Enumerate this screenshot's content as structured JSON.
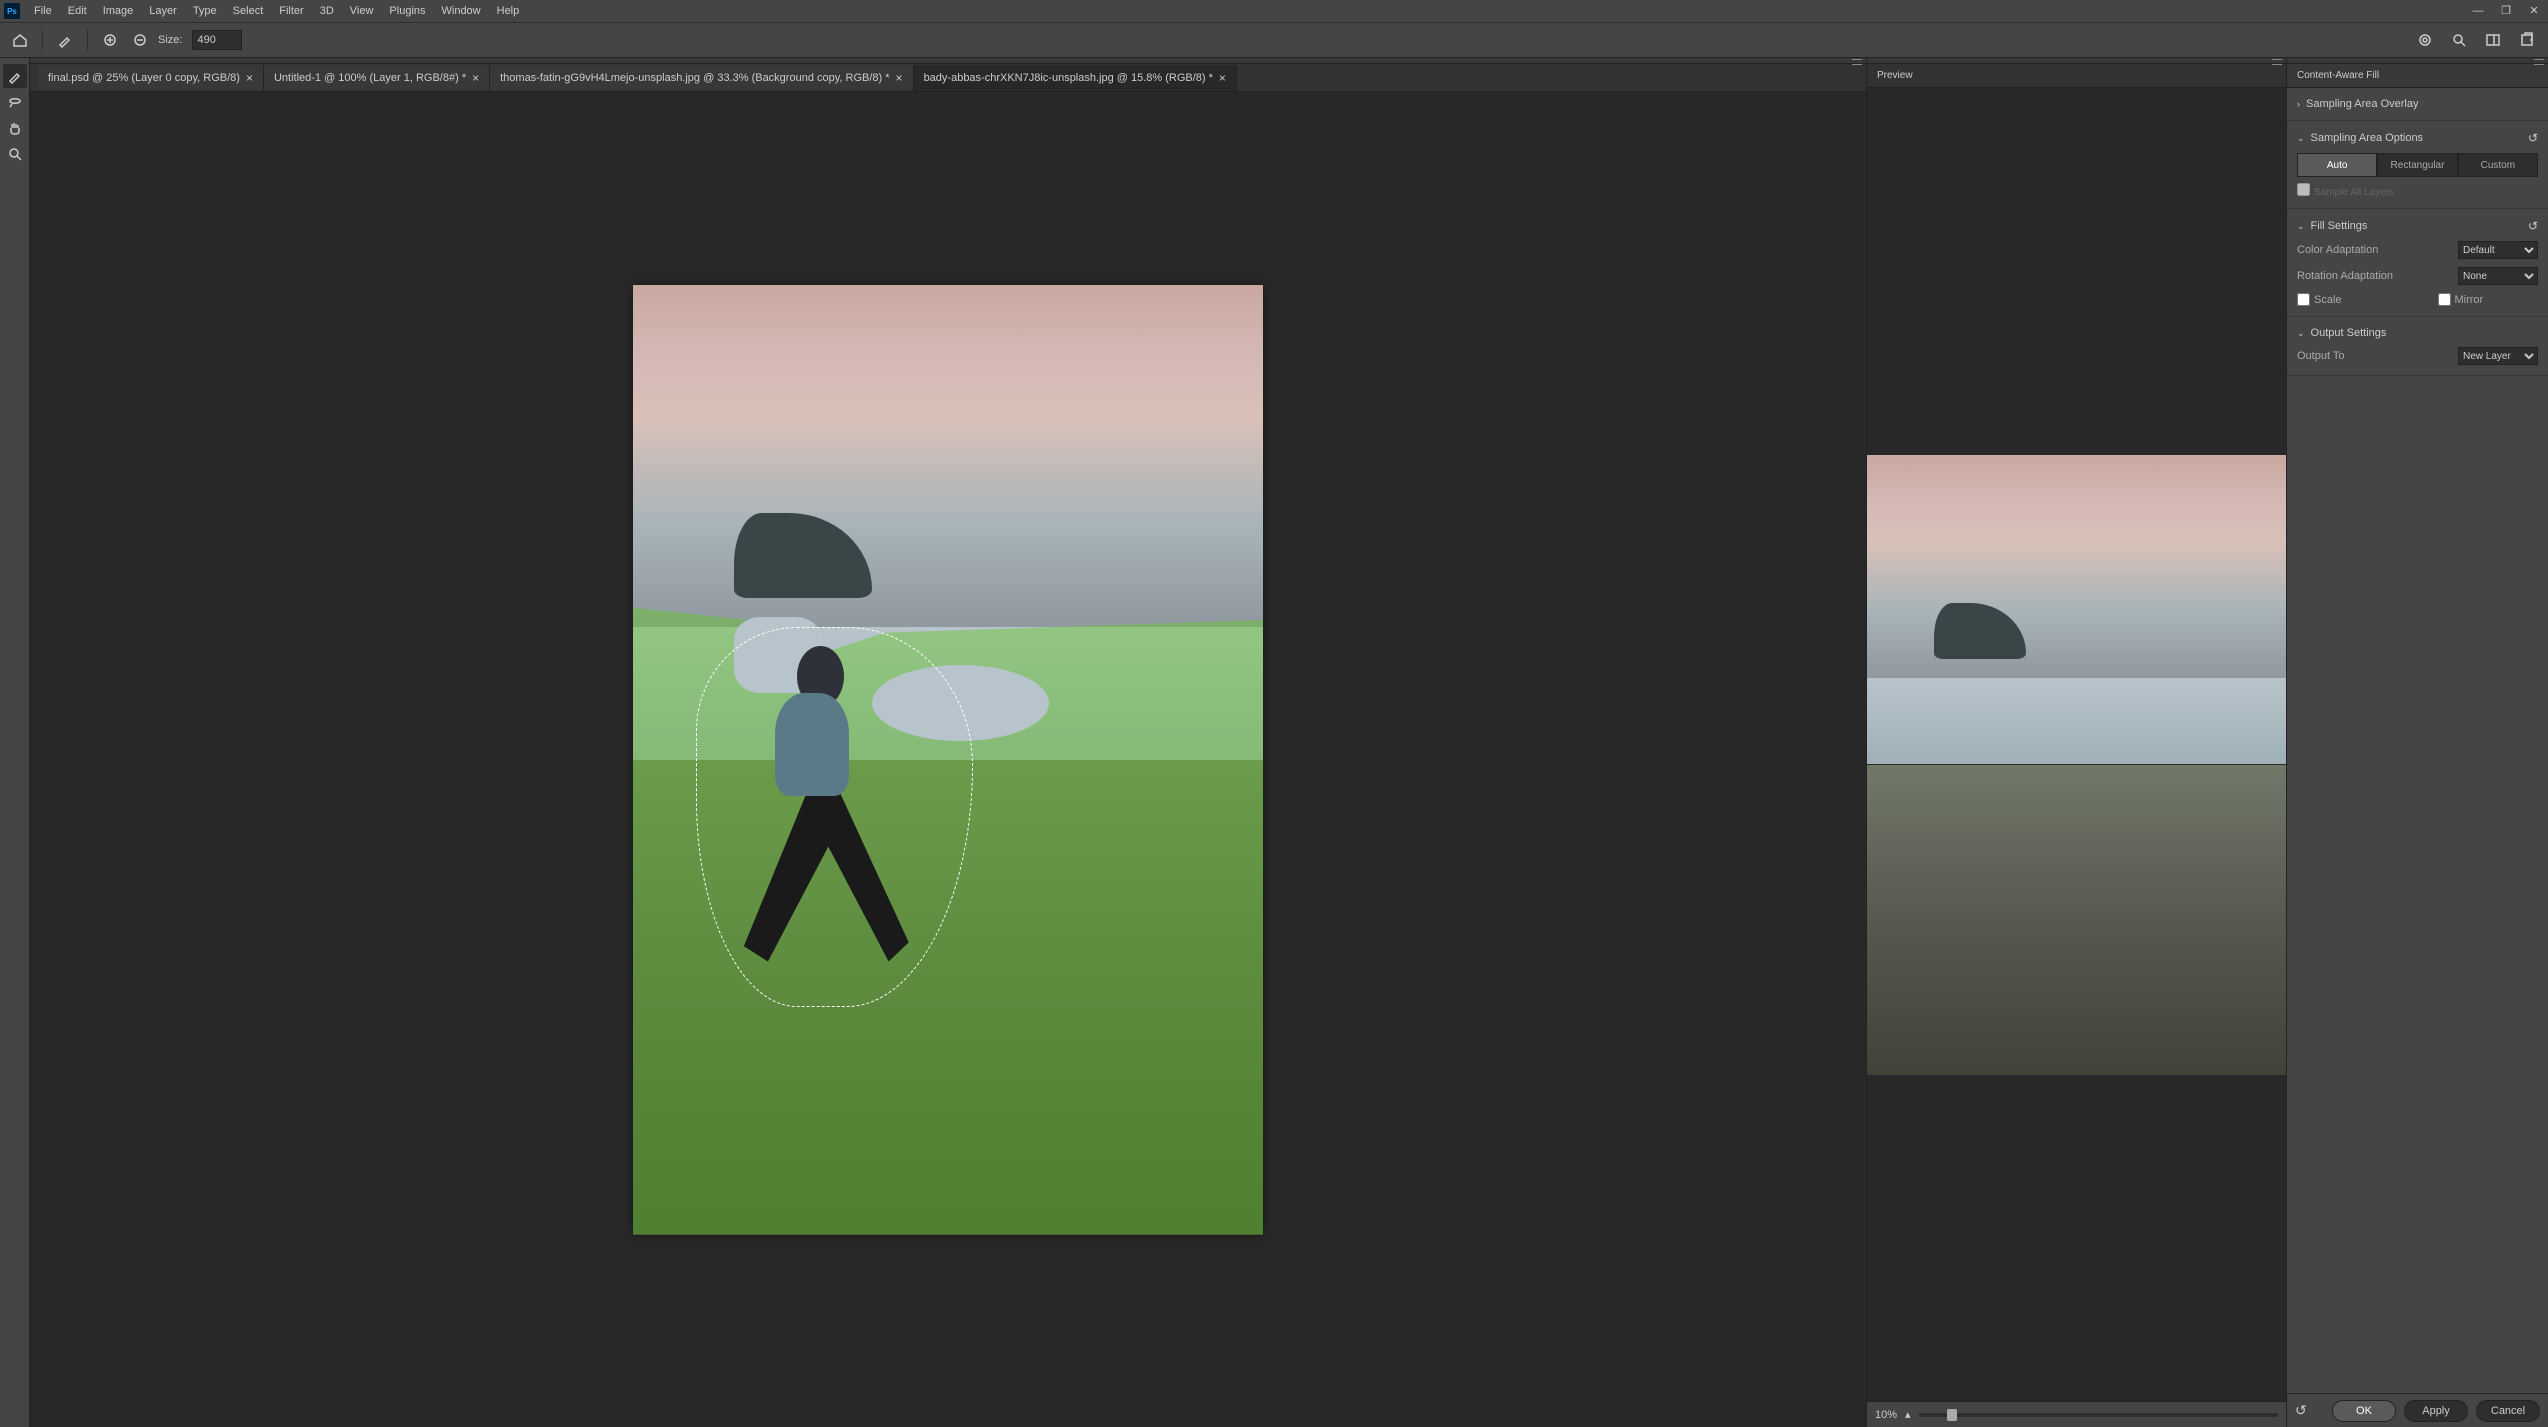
{
  "menubar": {
    "logo": "Ps",
    "items": [
      "File",
      "Edit",
      "Image",
      "Layer",
      "Type",
      "Select",
      "Filter",
      "3D",
      "View",
      "Plugins",
      "Window",
      "Help"
    ]
  },
  "optionsbar": {
    "size_label": "Size:",
    "size_value": "490"
  },
  "tabs": [
    {
      "label": "final.psd @ 25% (Layer 0 copy, RGB/8)"
    },
    {
      "label": "Untitled-1 @ 100% (Layer 1, RGB/8#) *"
    },
    {
      "label": "thomas-fatin-gG9vH4Lmejo-unsplash.jpg @ 33.3% (Background copy, RGB/8) *"
    },
    {
      "label": "bady-abbas-chrXKN7J8ic-unsplash.jpg @ 15.8% (RGB/8) *"
    }
  ],
  "active_tab": 3,
  "preview_panel": {
    "title": "Preview",
    "zoom": "10%"
  },
  "right_panel": {
    "title": "Content-Aware Fill",
    "sections": {
      "sampling_overlay": "Sampling Area Overlay",
      "sampling_options": "Sampling Area Options",
      "sample_all": "Sample All Layers",
      "fill_settings": "Fill Settings",
      "color_adapt": "Color Adaptation",
      "color_adapt_val": "Default",
      "rot_adapt": "Rotation Adaptation",
      "rot_adapt_val": "None",
      "scale": "Scale",
      "mirror": "Mirror",
      "output": "Output Settings",
      "output_to": "Output To",
      "output_to_val": "New Layer"
    },
    "seg": [
      "Auto",
      "Rectangular",
      "Custom"
    ],
    "buttons": {
      "ok": "OK",
      "apply": "Apply",
      "cancel": "Cancel"
    }
  }
}
